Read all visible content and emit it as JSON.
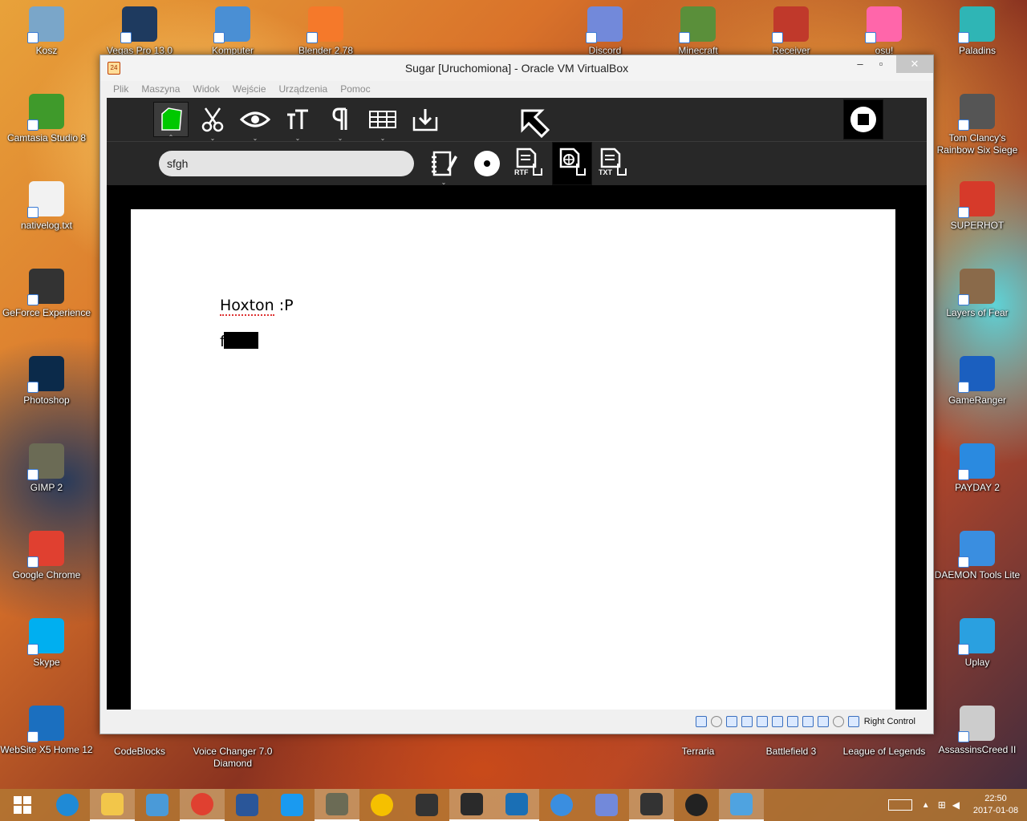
{
  "desktop_icons_left": [
    {
      "label": "Kosz",
      "icon": "recycle-bin-icon",
      "color": "#7aa6c9"
    },
    {
      "label": "Camtasia Studio 8",
      "icon": "camtasia-icon",
      "color": "#3f9a2b"
    },
    {
      "label": "nativelog.txt",
      "icon": "text-file-icon",
      "color": "#f2f2f2"
    },
    {
      "label": "GeForce Experience",
      "icon": "geforce-icon",
      "color": "#333333"
    },
    {
      "label": "Photoshop",
      "icon": "photoshop-icon",
      "color": "#0b2a4a"
    },
    {
      "label": "GIMP 2",
      "icon": "gimp-icon",
      "color": "#6b6b55"
    },
    {
      "label": "Google Chrome",
      "icon": "chrome-icon",
      "color": "#e04030"
    },
    {
      "label": "Skype",
      "icon": "skype-icon",
      "color": "#00aff0"
    },
    {
      "label": "WebSite X5 Home 12",
      "icon": "websitex5-icon",
      "color": "#1b6fbf"
    }
  ],
  "desktop_icons_top": [
    {
      "label": "Vegas Pro 13.0",
      "icon": "vegas-icon",
      "color": "#1e3a5f"
    },
    {
      "label": "Komputer",
      "icon": "computer-icon",
      "color": "#4a8fd4"
    },
    {
      "label": "Blender 2.78",
      "icon": "blender-icon",
      "color": "#f5792a"
    },
    {
      "label": "Discord",
      "icon": "discord-icon",
      "color": "#7289da"
    },
    {
      "label": "Minecraft",
      "icon": "minecraft-icon",
      "color": "#5a8f3a"
    },
    {
      "label": "Receiver",
      "icon": "receiver-icon",
      "color": "#c0392b"
    },
    {
      "label": "osu!",
      "icon": "osu-icon",
      "color": "#ff66aa"
    }
  ],
  "desktop_icons_right": [
    {
      "label": "Paladins",
      "icon": "paladins-icon",
      "color": "#2fb5b5"
    },
    {
      "label": "Tom Clancy's Rainbow Six Siege",
      "icon": "rainbow-six-icon",
      "color": "#555555"
    },
    {
      "label": "SUPERHOT",
      "icon": "superhot-icon",
      "color": "#d63a2a"
    },
    {
      "label": "Layers of Fear",
      "icon": "layers-of-fear-icon",
      "color": "#8a6a4a"
    },
    {
      "label": "GameRanger",
      "icon": "gameranger-icon",
      "color": "#1b5fbf"
    },
    {
      "label": "PAYDAY 2",
      "icon": "payday2-icon",
      "color": "#2a8ae0"
    },
    {
      "label": "DAEMON Tools Lite",
      "icon": "daemon-tools-icon",
      "color": "#3a8ee0"
    },
    {
      "label": "Uplay",
      "icon": "uplay-icon",
      "color": "#2aa0e0"
    },
    {
      "label": "AssassinsCreed II",
      "icon": "assassins-creed-icon",
      "color": "#cccccc"
    }
  ],
  "desktop_icons_bottom": [
    {
      "label": "CodeBlocks",
      "icon": "codeblocks-icon"
    },
    {
      "label": "Voice Changer 7.0 Diamond",
      "icon": "voice-changer-icon"
    },
    {
      "label": "Terraria",
      "icon": "terraria-icon"
    },
    {
      "label": "Battlefield 3",
      "icon": "battlefield-icon"
    },
    {
      "label": "League of Legends",
      "icon": "lol-icon"
    }
  ],
  "window": {
    "title": "Sugar [Uruchomiona] - Oracle VM VirtualBox",
    "menu": [
      "Plik",
      "Maszyna",
      "Widok",
      "Wejście",
      "Urządzenia",
      "Pomoc"
    ],
    "min_label": "‒",
    "max_label": "▫",
    "close_label": "✕"
  },
  "sugar": {
    "search_value": "sfgh",
    "document_lines": {
      "line1_word": "Hoxton",
      "line1_rest": " :P",
      "line2": "f"
    },
    "toolbar_icons": [
      "activity-icon",
      "edit-icon",
      "view-icon",
      "text-icon",
      "paragraph-icon",
      "table-icon",
      "insert-image-icon",
      "pointer-icon",
      "stop-icon"
    ],
    "export_icons": [
      "notebook-icon",
      "record-icon",
      "export-rtf-icon",
      "export-html-icon",
      "export-txt-icon"
    ],
    "rtf_label": "RTF",
    "txt_label": "TXT",
    "accent": "#00c800"
  },
  "statusbar": {
    "host_key": "Right Control"
  },
  "taskbar": {
    "time": "22:50",
    "date": "2017-01-08"
  }
}
